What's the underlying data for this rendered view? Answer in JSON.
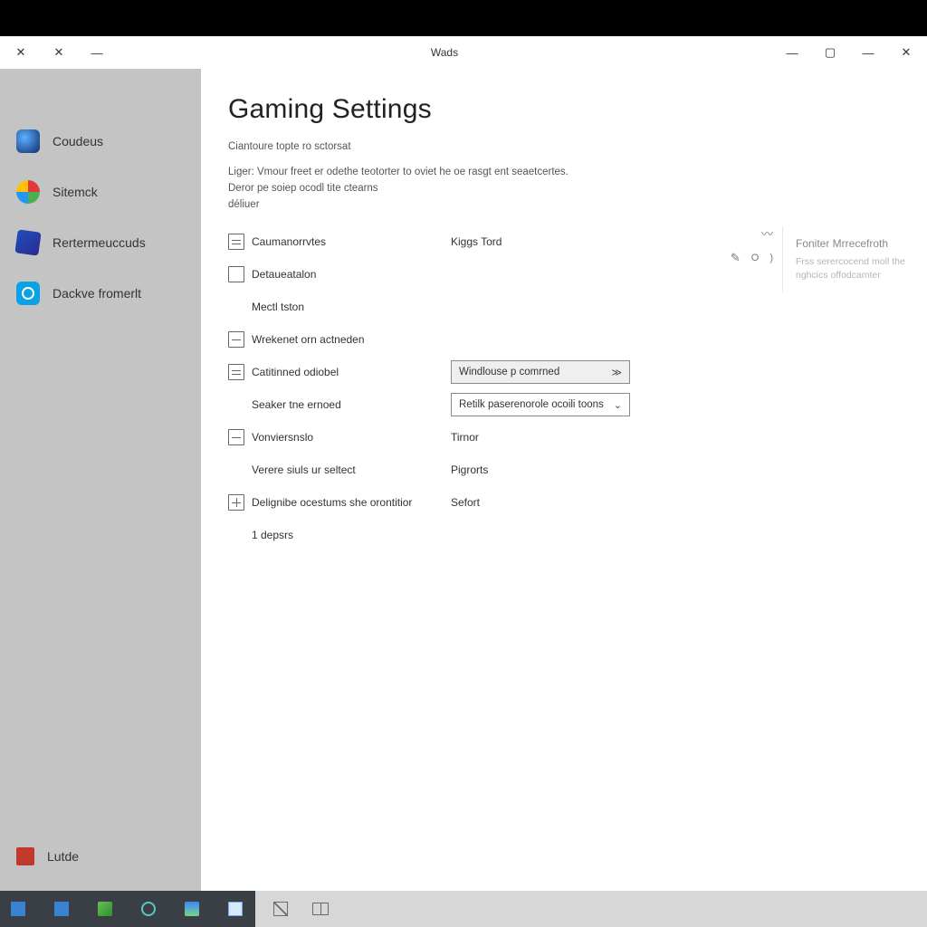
{
  "titlebar": {
    "title": "Wads"
  },
  "sidebar": {
    "items": [
      {
        "label": "Coudeus"
      },
      {
        "label": "Sitemck"
      },
      {
        "label": "Rertermeuccuds"
      },
      {
        "label": "Dackve fromerlt"
      }
    ],
    "bottom": {
      "label": "Lutde"
    }
  },
  "main": {
    "title": "Gaming Settings",
    "subtitle": "Ciantoure topte ro sctorsat",
    "desc_line1": "Liger: Vmour freet er odethe teotorter to oviet he oe rasgt ent seaetcertes.",
    "desc_line2": "Deror pe soiep ocodl tite ctearns",
    "desc_line3": "déliuer",
    "rows": [
      {
        "label": "Caumanorrvtes",
        "value": "Kiggs Tord"
      },
      {
        "label": "Detaueatalon",
        "value": ""
      },
      {
        "label": "Mectl tston",
        "value": ""
      },
      {
        "label": "Wrekenet orn actneden",
        "value": ""
      },
      {
        "label": "Catitinned odiobel",
        "value": "Windlouse p comrned"
      },
      {
        "label": "Seaker tne ernoed",
        "value": "Retilk paserenorole ocoili toons"
      },
      {
        "label": "Vonviersnslo",
        "value": "Tirnor"
      },
      {
        "label": "Verere siuls ur seltect",
        "value": "Pigrorts"
      },
      {
        "label": "Delignibe ocestums she orontitior",
        "value": "Sefort"
      },
      {
        "label": "1 depsrs",
        "value": ""
      }
    ]
  },
  "info": {
    "title": "Foniter Mrrecefroth",
    "text": "Frss serercocend moll the nghcics offodcamter"
  }
}
